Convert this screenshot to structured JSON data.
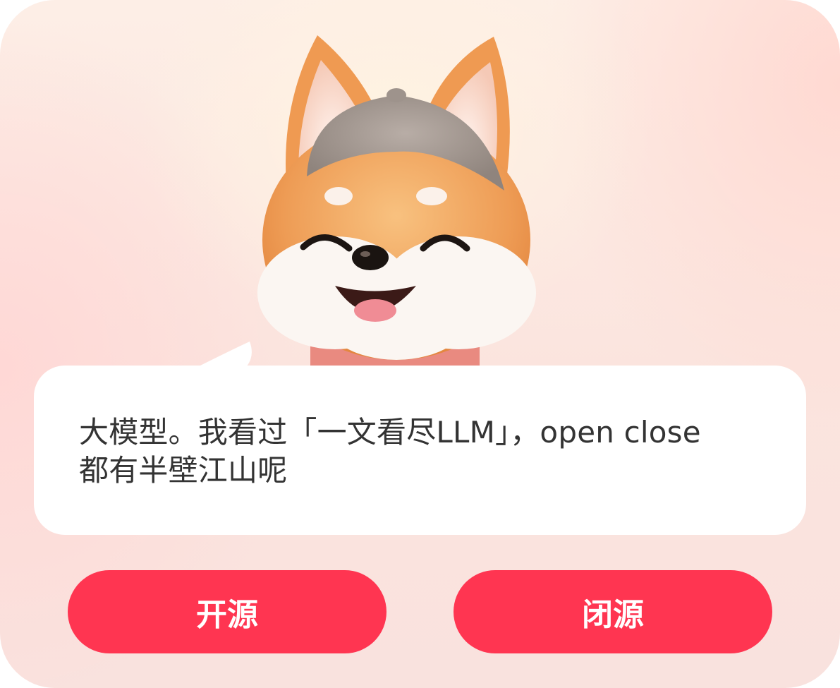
{
  "dialog": {
    "message": "大模型。我看过「一文看尽LLM」，open close都有半壁江山呢",
    "mascot": "shiba-inu-mascot-with-beanie-and-scarf"
  },
  "buttons": {
    "open_label": "开源",
    "close_label": "闭源"
  },
  "colors": {
    "accent": "#ff3551",
    "bubble": "#ffffff",
    "text": "#333333",
    "fur_orange": "#f0a15b",
    "hat_gray": "#a79c95",
    "scarf_pink": "#e98a80"
  }
}
